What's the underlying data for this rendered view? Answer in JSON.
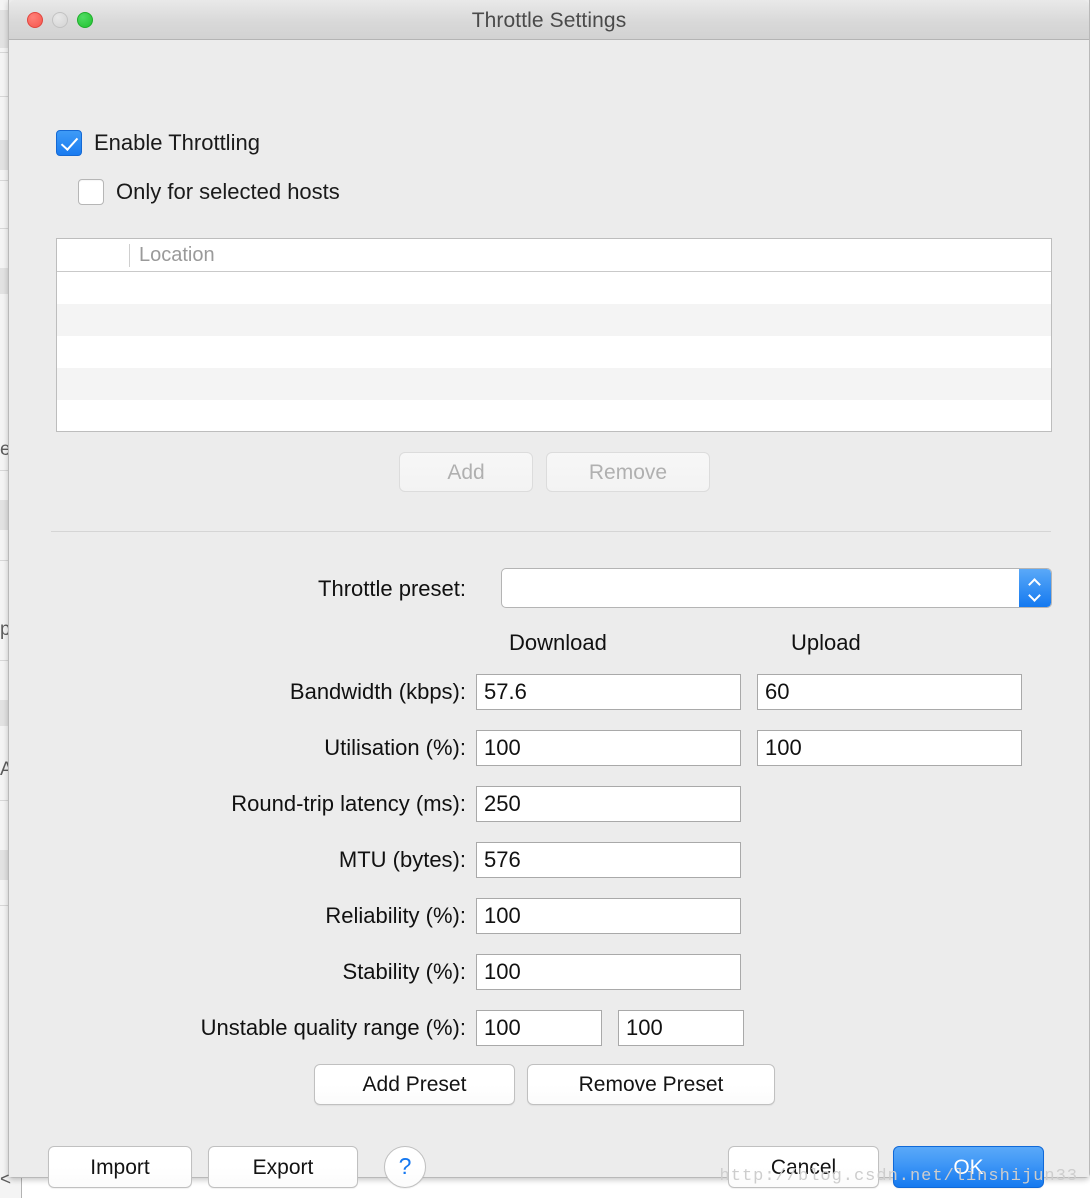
{
  "window": {
    "title": "Throttle Settings",
    "controls": {
      "close": "close-button",
      "minimize": "minimize-button",
      "zoom": "zoom-button"
    }
  },
  "options": {
    "enable_throttling": {
      "label": "Enable Throttling",
      "checked": true
    },
    "only_selected_hosts": {
      "label": "Only for selected hosts",
      "checked": false
    }
  },
  "hosts_table": {
    "columns": [
      "",
      "Location"
    ],
    "rows": [
      {
        "check": "",
        "location": ""
      },
      {
        "check": "",
        "location": ""
      },
      {
        "check": "",
        "location": ""
      },
      {
        "check": "",
        "location": ""
      },
      {
        "check": "",
        "location": ""
      }
    ],
    "add_label": "Add",
    "remove_label": "Remove",
    "add_enabled": false,
    "remove_enabled": false
  },
  "preset": {
    "label": "Throttle preset:",
    "value": "",
    "options": [],
    "add_label": "Add Preset",
    "remove_label": "Remove Preset"
  },
  "columns": {
    "download": "Download",
    "upload": "Upload"
  },
  "fields": [
    {
      "label": "Bandwidth (kbps):",
      "download": "57.6",
      "upload": "60",
      "has_upload": true,
      "split": false
    },
    {
      "label": "Utilisation (%):",
      "download": "100",
      "upload": "100",
      "has_upload": true,
      "split": false
    },
    {
      "label": "Round-trip latency (ms):",
      "download": "250",
      "upload": "",
      "has_upload": false,
      "split": false
    },
    {
      "label": "MTU (bytes):",
      "download": "576",
      "upload": "",
      "has_upload": false,
      "split": false
    },
    {
      "label": "Reliability (%):",
      "download": "100",
      "upload": "",
      "has_upload": false,
      "split": false
    },
    {
      "label": "Stability (%):",
      "download": "100",
      "upload": "",
      "has_upload": false,
      "split": false
    },
    {
      "label": "Unstable quality range (%):",
      "download": "100",
      "upload": "100",
      "has_upload": true,
      "split": true
    }
  ],
  "footer": {
    "import_label": "Import",
    "export_label": "Export",
    "help_label": "?",
    "cancel_label": "Cancel",
    "ok_label": "OK"
  },
  "watermark": "http://blog.csdn.net/linshijun33",
  "colors": {
    "accent": "#1479f0",
    "window_bg": "#ececec",
    "titlebar": "#dadada",
    "close": "#f5564d",
    "minimize": "#d3d3d3",
    "zoom": "#22c12f",
    "field_border": "#a9a9a9",
    "disabled_text": "#b0b0b0"
  }
}
